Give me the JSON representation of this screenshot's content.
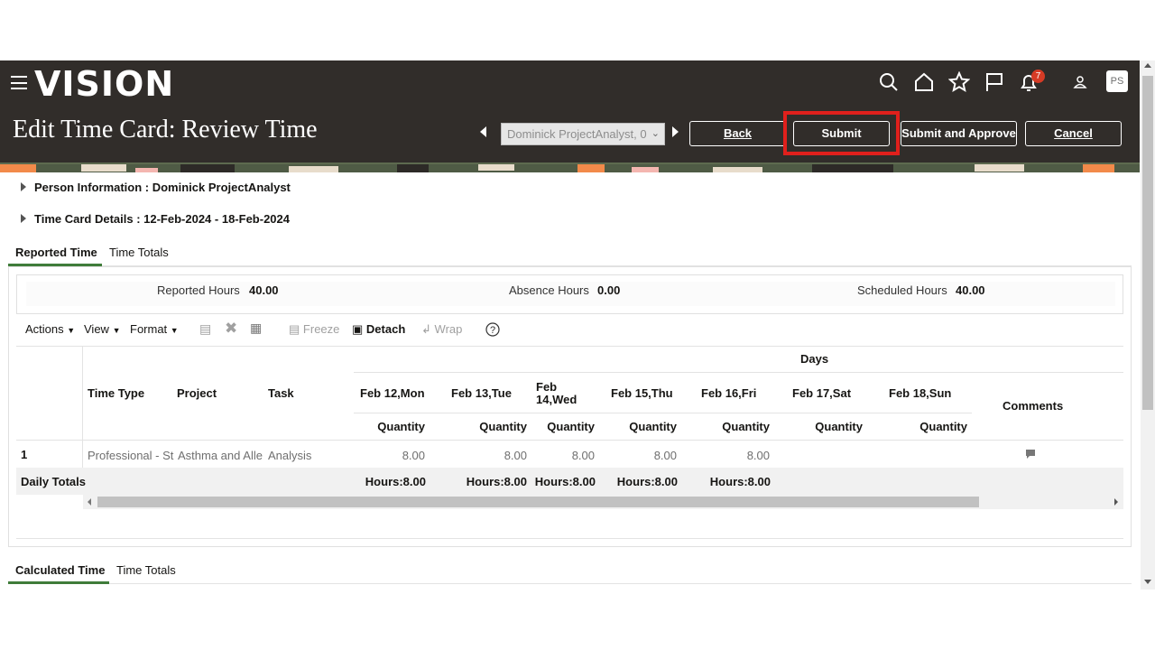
{
  "header": {
    "logo": "VISION",
    "notification_count": "7",
    "user_initials": "PS",
    "page_title": "Edit Time Card: Review Time",
    "person_selector_value": "Dominick ProjectAnalyst, 0",
    "buttons": {
      "back": "Back",
      "submit": "Submit",
      "submit_approve": "Submit and Approve",
      "cancel": "Cancel"
    },
    "icons": [
      "menu-icon",
      "search-icon",
      "home-icon",
      "star-icon",
      "flag-icon",
      "bell-icon",
      "user-icon"
    ]
  },
  "sections": {
    "person_info": "Person Information : Dominick ProjectAnalyst",
    "time_card_details": "Time Card Details : 12-Feb-2024 - 18-Feb-2024"
  },
  "tabs": {
    "reported_time": "Reported Time",
    "time_totals": "Time Totals",
    "calculated_time": "Calculated Time",
    "time_totals_2": "Time Totals"
  },
  "summary": {
    "reported_hours_label": "Reported Hours",
    "reported_hours_value": "40.00",
    "absence_hours_label": "Absence Hours",
    "absence_hours_value": "0.00",
    "scheduled_hours_label": "Scheduled Hours",
    "scheduled_hours_value": "40.00"
  },
  "toolbar": {
    "actions": "Actions",
    "view": "View",
    "format": "Format",
    "freeze": "Freeze",
    "detach": "Detach",
    "wrap": "Wrap"
  },
  "table": {
    "days_header": "Days",
    "columns": {
      "time_type": "Time Type",
      "project": "Project",
      "task": "Task",
      "comments": "Comments"
    },
    "days": [
      "Feb 12,Mon",
      "Feb 13,Tue",
      "Feb 14,Wed",
      "Feb 15,Thu",
      "Feb 16,Fri",
      "Feb 17,Sat",
      "Feb 18,Sun"
    ],
    "day_14_line1": "Feb",
    "day_14_line2": "14,Wed",
    "sub_header": "Quantity",
    "rows": [
      {
        "num": "1",
        "time_type": "Professional - St",
        "project": "Asthma and Alle",
        "task": "Analysis",
        "values": [
          "8.00",
          "8.00",
          "8.00",
          "8.00",
          "8.00",
          "",
          ""
        ]
      }
    ],
    "daily_totals_label": "Daily Totals",
    "daily_totals": [
      "Hours:8.00",
      "Hours:8.00",
      "Hours:8.00",
      "Hours:8.00",
      "Hours:8.00",
      "",
      ""
    ]
  },
  "colors": {
    "header_bg": "#312d2a",
    "highlight": "#e0201c",
    "tab_underline": "#3f7c3a",
    "badge": "#d63b25"
  }
}
